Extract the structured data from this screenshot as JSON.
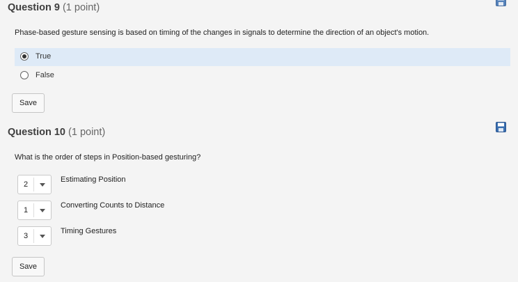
{
  "question9": {
    "title": "Question 9",
    "points": "(1 point)",
    "text": "Phase-based gesture sensing is based on timing of the changes in signals to determine the direction of an object's motion.",
    "options": [
      {
        "label": "True",
        "selected": true
      },
      {
        "label": "False",
        "selected": false
      }
    ],
    "save_label": "Save"
  },
  "question10": {
    "title": "Question 10",
    "points": "(1 point)",
    "text": "What is the order of steps in Position-based gesturing?",
    "items": [
      {
        "value": "2",
        "label": "Estimating Position"
      },
      {
        "value": "1",
        "label": "Converting Counts to Distance"
      },
      {
        "value": "3",
        "label": "Timing Gestures"
      }
    ],
    "save_label": "Save"
  },
  "icons": {
    "save": "save-disk-icon"
  },
  "colors": {
    "selected_option_bg": "#deeaf7",
    "save_icon": "#3a6fb0"
  }
}
